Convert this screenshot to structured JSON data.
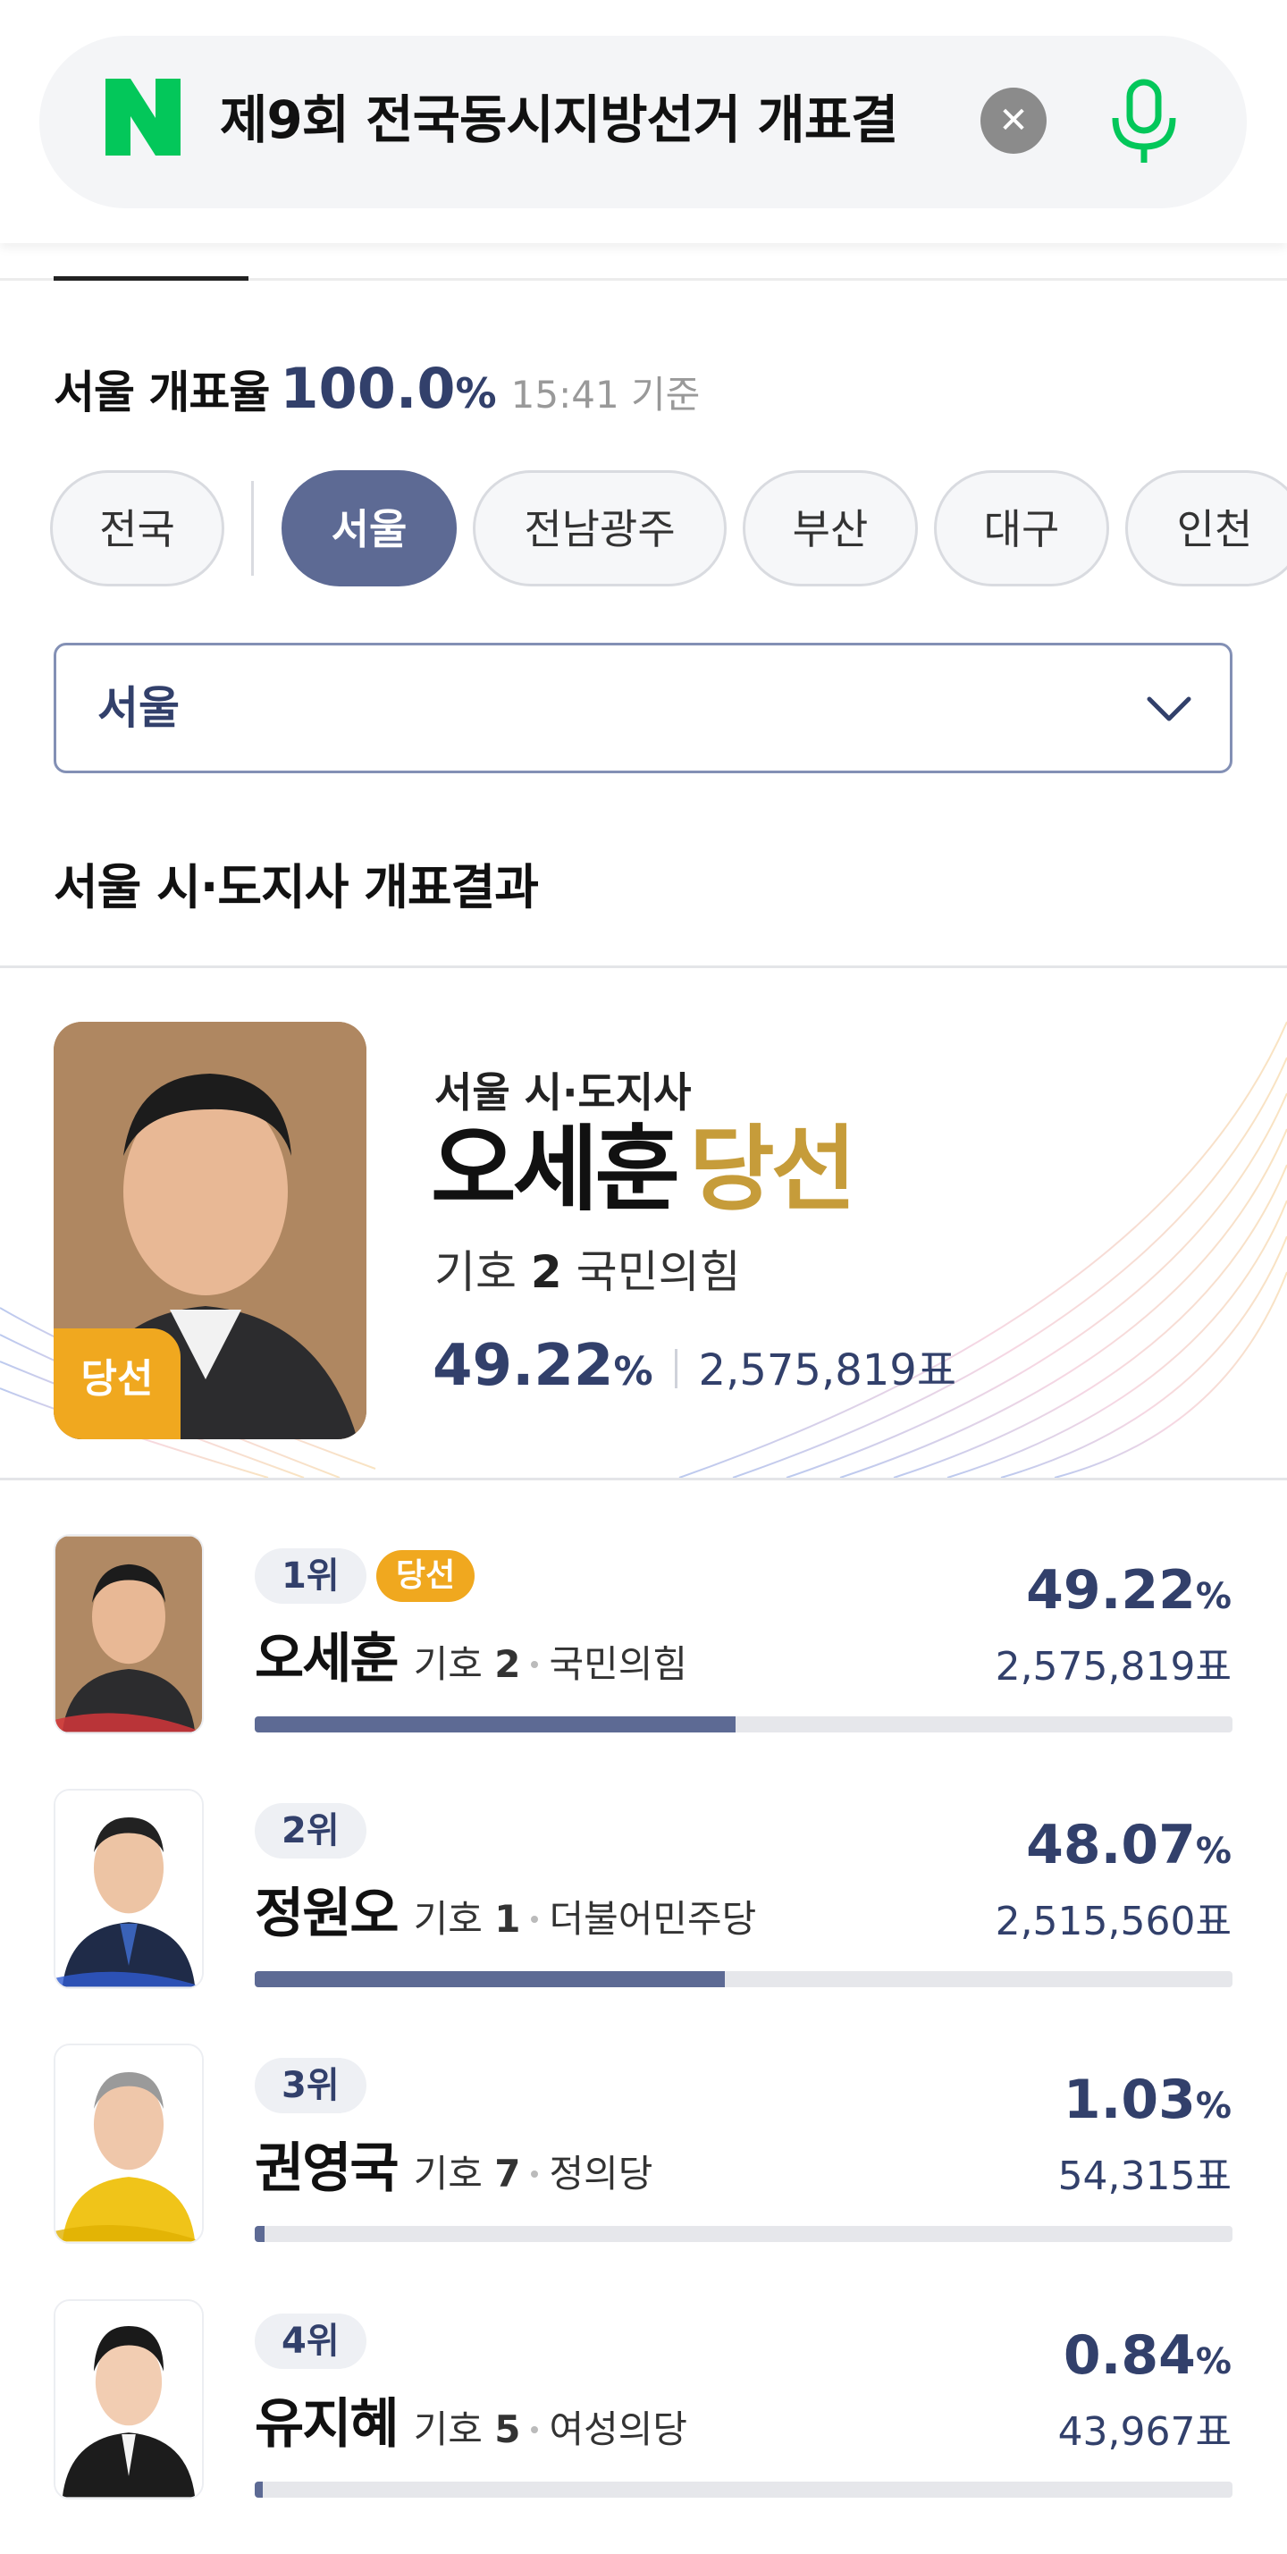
{
  "search": {
    "query": "제9회 전국동시지방선거 개표결",
    "clear_icon": "close-icon",
    "mic_icon": "microphone-icon",
    "brand": "N"
  },
  "turnout": {
    "label": "서울 개표율",
    "value": "100.0",
    "unit": "%",
    "time": "15:41 기준"
  },
  "regions": {
    "items": [
      "전국",
      "서울",
      "전남광주",
      "부산",
      "대구",
      "인천"
    ],
    "selected": "서울"
  },
  "dropdown": {
    "value": "서울"
  },
  "section_title": "서울 시·도지사 개표결과",
  "winner": {
    "badge": "당선",
    "office": "서울 시·도지사",
    "name": "오세훈",
    "status": "당선",
    "number_label": "기호",
    "number": "2",
    "party": "국민의힘",
    "pct": "49.22",
    "pct_unit": "%",
    "votes": "2,575,819표"
  },
  "candidates": [
    {
      "rank": "1위",
      "winner_tag": "당선",
      "name": "오세훈",
      "number_label": "기호",
      "number": "2",
      "party": "국민의힘",
      "pct": "49.22",
      "pct_unit": "%",
      "votes": "2,575,819표",
      "share": 49.22
    },
    {
      "rank": "2위",
      "winner_tag": "",
      "name": "정원오",
      "number_label": "기호",
      "number": "1",
      "party": "더불어민주당",
      "pct": "48.07",
      "pct_unit": "%",
      "votes": "2,515,560표",
      "share": 48.07
    },
    {
      "rank": "3위",
      "winner_tag": "",
      "name": "권영국",
      "number_label": "기호",
      "number": "7",
      "party": "정의당",
      "pct": "1.03",
      "pct_unit": "%",
      "votes": "54,315표",
      "share": 1.03
    },
    {
      "rank": "4위",
      "winner_tag": "",
      "name": "유지혜",
      "number_label": "기호",
      "number": "5",
      "party": "여성의당",
      "pct": "0.84",
      "pct_unit": "%",
      "votes": "43,967표",
      "share": 0.84
    }
  ],
  "colors": {
    "accent": "#5d6a94",
    "navy_text": "#32406b",
    "winner_gold": "#c69c3a",
    "badge_orange": "#f0a81f",
    "naver_green": "#03c75a"
  }
}
